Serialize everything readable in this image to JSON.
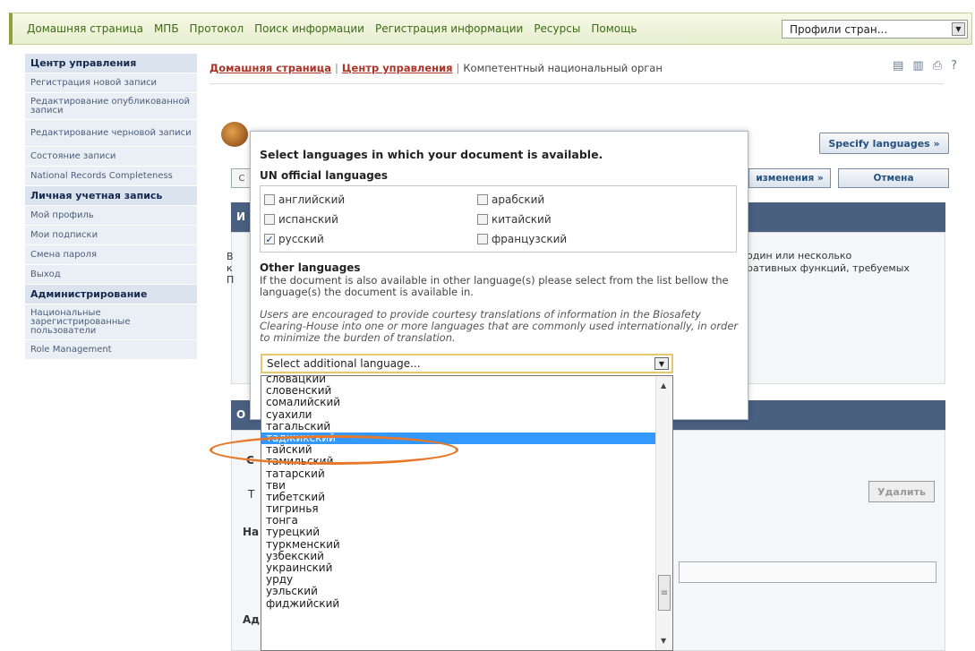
{
  "topnav": {
    "items": [
      "Домашняя страница",
      "МПБ",
      "Протокол",
      "Поиск информации",
      "Регистрация информации",
      "Ресурсы",
      "Помощь"
    ],
    "profile_select": "Профили стран..."
  },
  "sidebar": {
    "sections": [
      {
        "title": "Центр управления",
        "items": [
          "Регистрация новой записи",
          "Редактирование опубликованной записи",
          "Редактирование черновой записи",
          "Состояние записи",
          "National Records Completeness"
        ]
      },
      {
        "title": "Личная учетная запись",
        "items": [
          "Мой профиль",
          "Мои подписки",
          "Смена пароля",
          "Выход"
        ]
      },
      {
        "title": "Администрирование",
        "items": [
          "Национальные зарегистрированные пользователи",
          "Role Management"
        ]
      }
    ]
  },
  "breadcrumb": {
    "home": "Домашняя страница",
    "sep": "|",
    "center": "Центр управления",
    "current": "Компетентный национальный орган"
  },
  "buttons": {
    "specify": "Specify languages »",
    "save_changes": "изменения »",
    "cancel": "Отмена",
    "delete": "Удалить"
  },
  "background_fragments": {
    "info_right_1": "один или несколько",
    "info_right_2": "ративных функций, требуемых",
    "left_c": "С",
    "i": "И",
    "v": "В",
    "k": "к",
    "p": "П",
    "o": "О",
    "s": "С",
    "t": "Т",
    "na": "На",
    "ad": "Ад"
  },
  "modal": {
    "title": "Select languages in which your document is available.",
    "un_label": "UN official languages",
    "un_languages": [
      {
        "label": "английский",
        "checked": false
      },
      {
        "label": "арабский",
        "checked": false
      },
      {
        "label": "испанский",
        "checked": false
      },
      {
        "label": "китайский",
        "checked": false
      },
      {
        "label": "русский",
        "checked": true
      },
      {
        "label": "французский",
        "checked": false
      }
    ],
    "other_label": "Other languages",
    "other_desc": "If the document is also available in other language(s) please select from the list bellow the language(s) the document is available in.",
    "courtesy_note": "Users are encouraged to provide courtesy translations of information in the Biosafety Clearing-House into one or more languages that are commonly used internationally, in order to minimize the burden of translation.",
    "select_placeholder": "Select additional language..."
  },
  "dropdown": {
    "items": [
      "словацкий",
      "словенский",
      "сомалийский",
      "суахили",
      "тагальский",
      "таджикский",
      "тайский",
      "тамильский",
      "татарский",
      "тви",
      "тибетский",
      "тигринья",
      "тонга",
      "турецкий",
      "туркменский",
      "узбекский",
      "украинский",
      "урду",
      "уэльский",
      "фиджийский"
    ],
    "selected": "таджикский"
  },
  "colors": {
    "accent_green": "#8ca23c",
    "panel_blue": "#4a6080",
    "selection_blue": "#3399ff",
    "highlight_orange": "#e8782a"
  }
}
